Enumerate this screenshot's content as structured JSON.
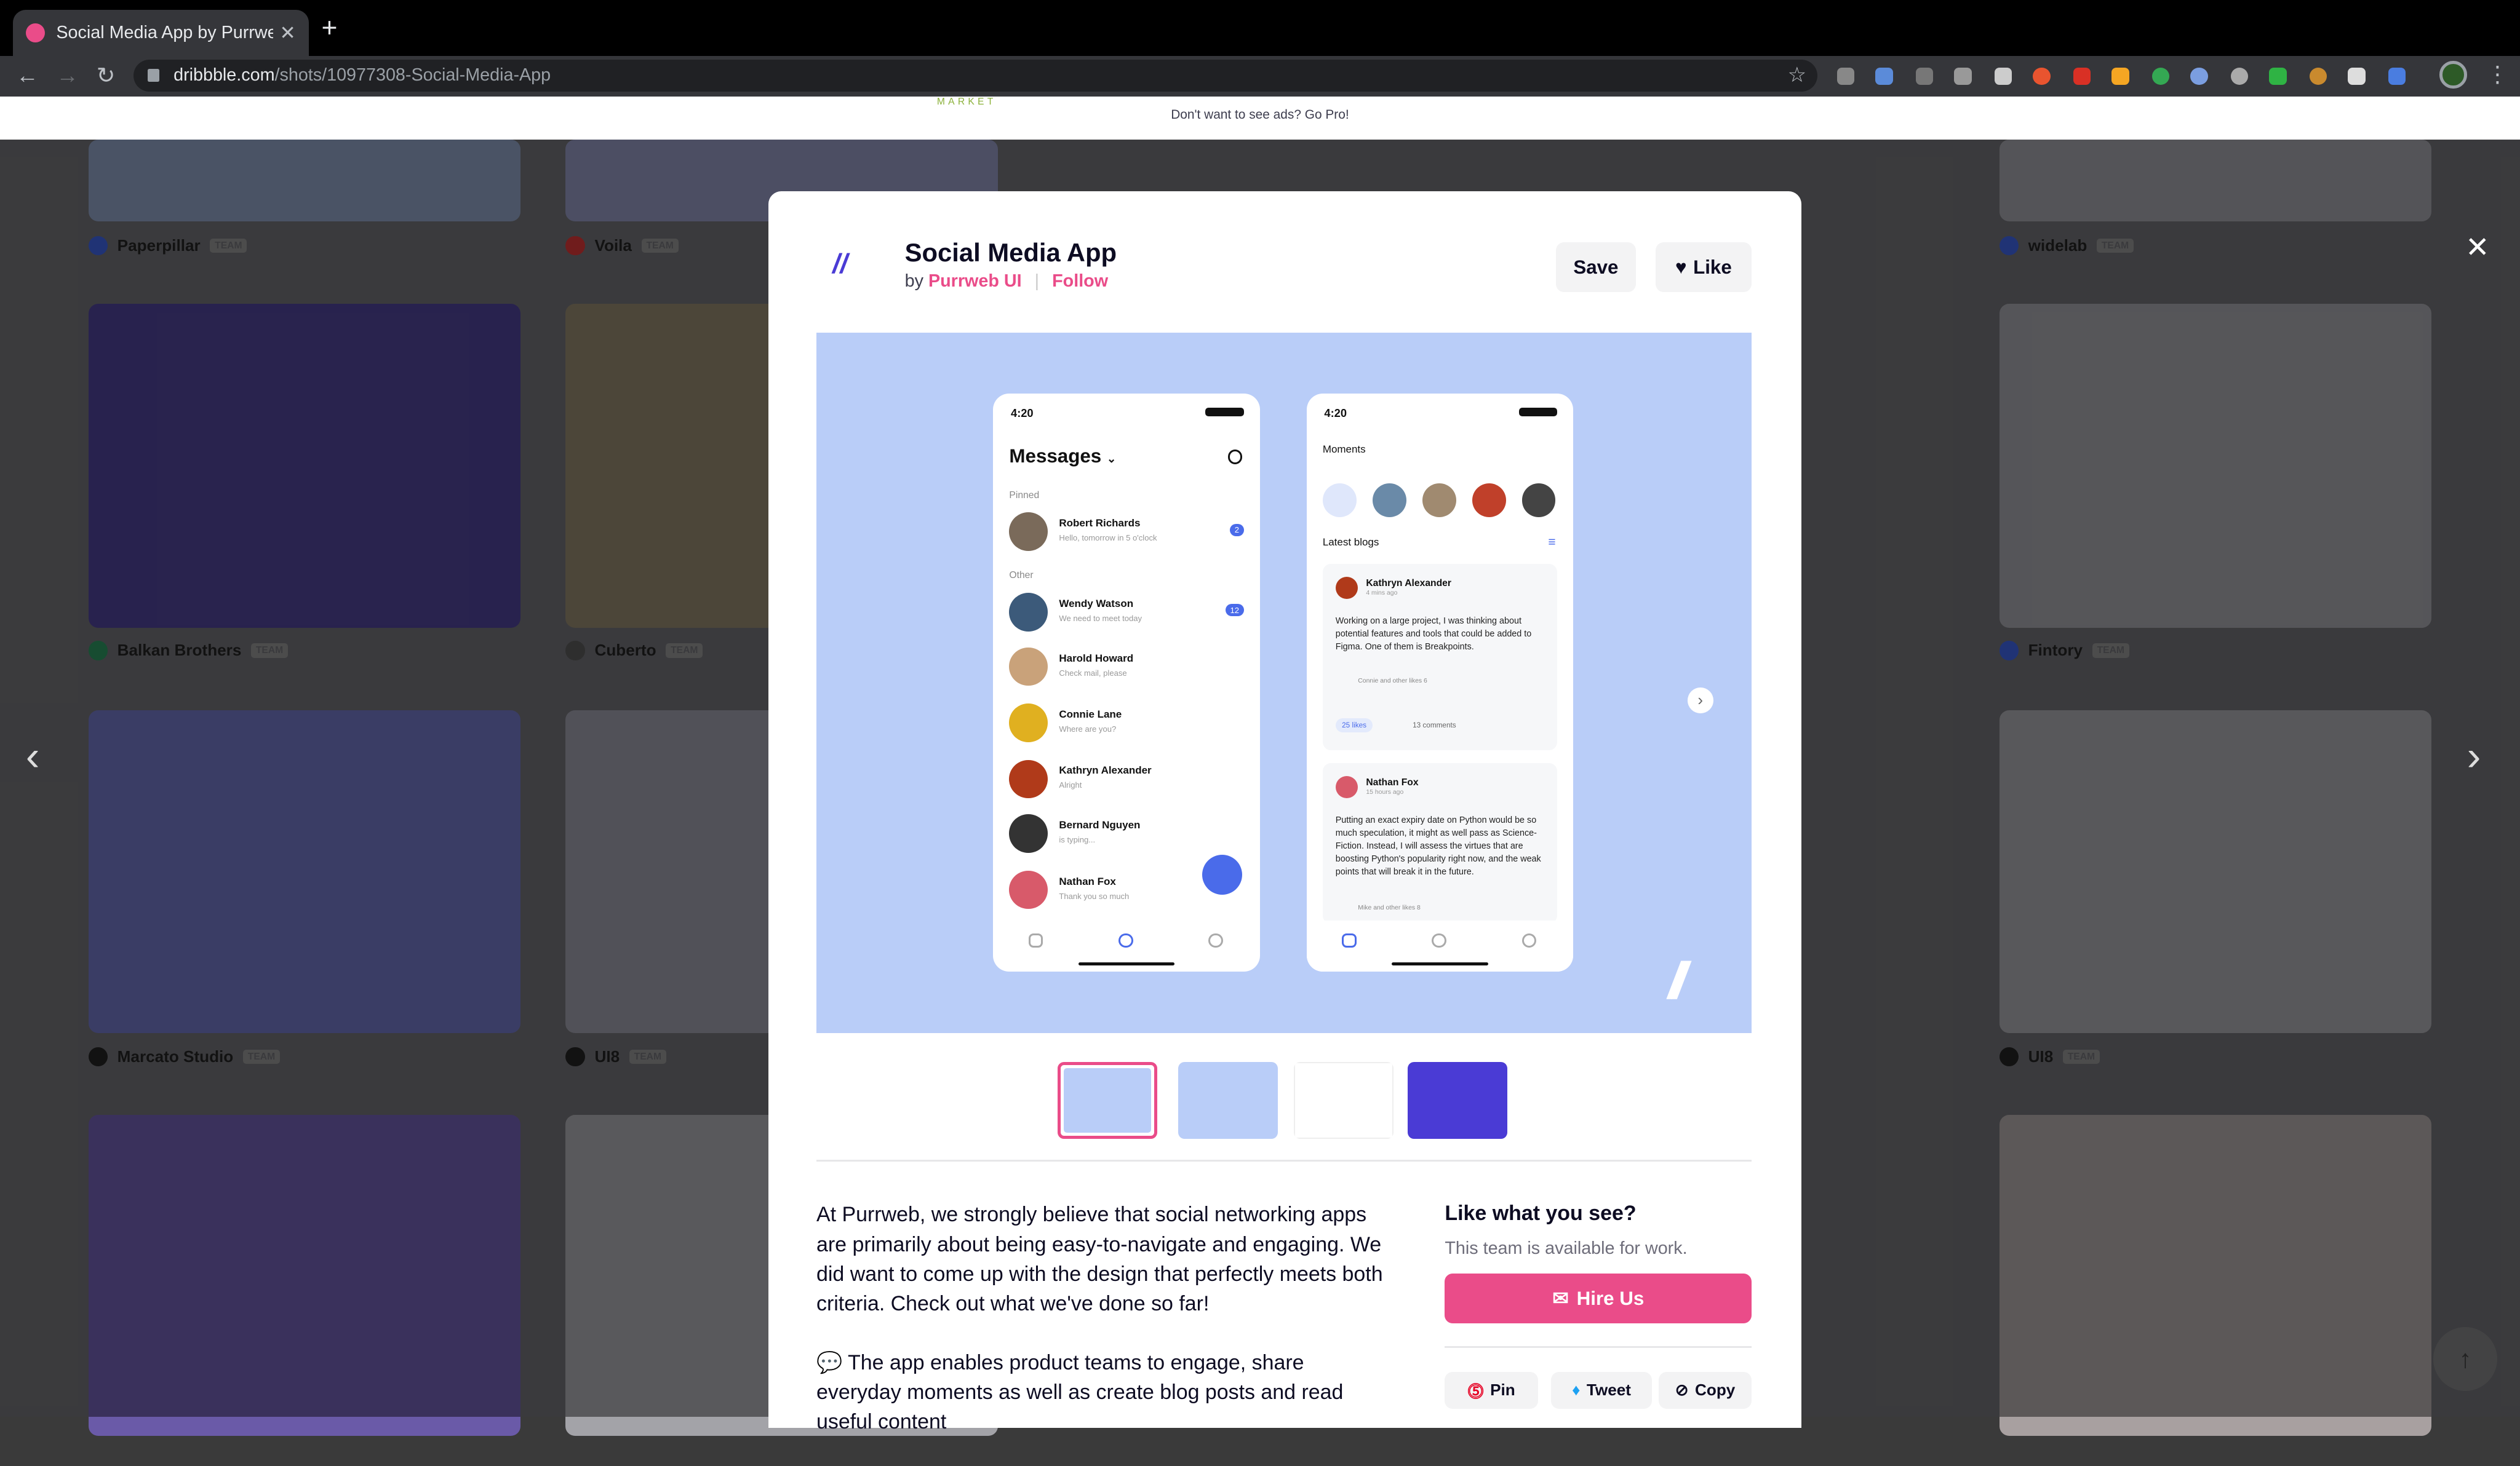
{
  "browser": {
    "tab_title": "Social Media App by Purrweb U",
    "url_host": "dribbble.com",
    "url_path": "/shots/10977308-Social-Media-App"
  },
  "adbar": {
    "message": "Don't want to see ads? Go Pro!",
    "brand_fragment": "MARKET"
  },
  "background_grid": {
    "authors": [
      {
        "name": "Paperpillar",
        "badge": "TEAM"
      },
      {
        "name": "Voila",
        "badge": "TEAM"
      },
      {
        "name": "widelab",
        "badge": "TEAM"
      },
      {
        "name": "Balkan Brothers",
        "badge": "TEAM"
      },
      {
        "name": "Cuberto",
        "badge": "TEAM"
      },
      {
        "name": "Fintory",
        "badge": "TEAM"
      },
      {
        "name": "Marcato Studio",
        "badge": "TEAM"
      },
      {
        "name": "UI8",
        "badge": "TEAM"
      },
      {
        "name": "UI8",
        "badge": "TEAM"
      }
    ]
  },
  "shot": {
    "title": "Social Media App",
    "by": "by",
    "author": "Purrweb UI",
    "follow": "Follow",
    "save": "Save",
    "like": "Like"
  },
  "hero": {
    "messages_phone": {
      "time": "4:20",
      "title": "Messages",
      "pinned_label": "Pinned",
      "other_label": "Other",
      "pinned": [
        {
          "name": "Robert Richards",
          "msg": "Hello, tomorrow in 5 o'clock",
          "badge": "2"
        }
      ],
      "other": [
        {
          "name": "Wendy Watson",
          "msg": "We need to meet today",
          "badge": "12"
        },
        {
          "name": "Harold Howard",
          "msg": "Check mail, please"
        },
        {
          "name": "Connie Lane",
          "msg": "Where are you?"
        },
        {
          "name": "Kathryn Alexander",
          "msg": "Alright"
        },
        {
          "name": "Bernard Nguyen",
          "msg": "is typing..."
        },
        {
          "name": "Nathan Fox",
          "msg": "Thank you so much"
        }
      ]
    },
    "feed_phone": {
      "time": "4:20",
      "moments_label": "Moments",
      "blogs_label": "Latest blogs",
      "posts": [
        {
          "author": "Kathryn Alexander",
          "time": "4 mins ago",
          "body": "Working on a large project, I was thinking about potential features and tools that could be added to Figma. One of them is Breakpoints.",
          "likers": "Connie and other likes 6",
          "likes": "25 likes",
          "comments": "13 comments"
        },
        {
          "author": "Nathan Fox",
          "time": "15 hours ago",
          "body": "Putting an exact expiry date on Python would be so much speculation, it might as well pass as Science-Fiction. Instead, I will assess the virtues that are boosting Python's popularity right now, and the weak points that will break it in the future.",
          "likers": "Mike and other likes 8"
        }
      ]
    }
  },
  "description": {
    "p1": "At Purrweb, we strongly believe that social networking apps are primarily about being easy-to-navigate and engaging. We did want to come up with the design that perfectly meets both criteria. Check out what we've done so far!",
    "p2": "💬  The app enables product teams to engage, share everyday moments as well as create blog posts and read useful content"
  },
  "sidebar": {
    "heading": "Like what you see?",
    "availability": "This team is available for work.",
    "hire_label": "Hire Us",
    "share": {
      "pin": "Pin",
      "tweet": "Tweet",
      "copy": "Copy"
    }
  },
  "colors": {
    "accent": "#ea4c89",
    "hero_bg": "#b9cdf8",
    "brand_blue": "#4a6bea"
  }
}
